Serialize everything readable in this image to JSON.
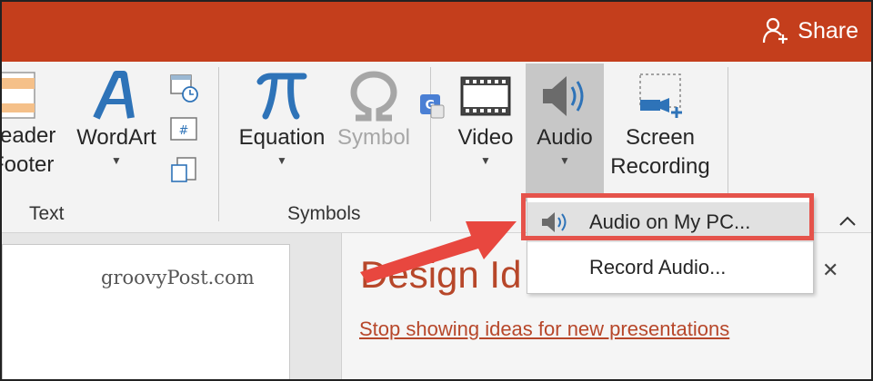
{
  "titlebar": {
    "share_label": "Share"
  },
  "ribbon": {
    "header_footer": {
      "line1": "eader",
      "line2": "Footer"
    },
    "wordart_label": "WordArt",
    "group_text": "Text",
    "equation_label": "Equation",
    "symbol_label": "Symbol",
    "group_symbols": "Symbols",
    "video_label": "Video",
    "audio_label": "Audio",
    "screen_recording": {
      "line1": "Screen",
      "line2": "Recording"
    }
  },
  "audio_menu": {
    "items": [
      {
        "label": "Audio on My PC..."
      },
      {
        "label": "Record Audio..."
      }
    ]
  },
  "slide": {
    "watermark": "groovyPost.com"
  },
  "design_pane": {
    "title": "Design Id",
    "link": "Stop showing ideas for new presentations"
  },
  "colors": {
    "titlebar": "#c43e1c",
    "accent_red": "#b7472a",
    "highlight": "#e5534b",
    "arrow": "#e8473f",
    "icon_blue": "#2e73b8"
  }
}
